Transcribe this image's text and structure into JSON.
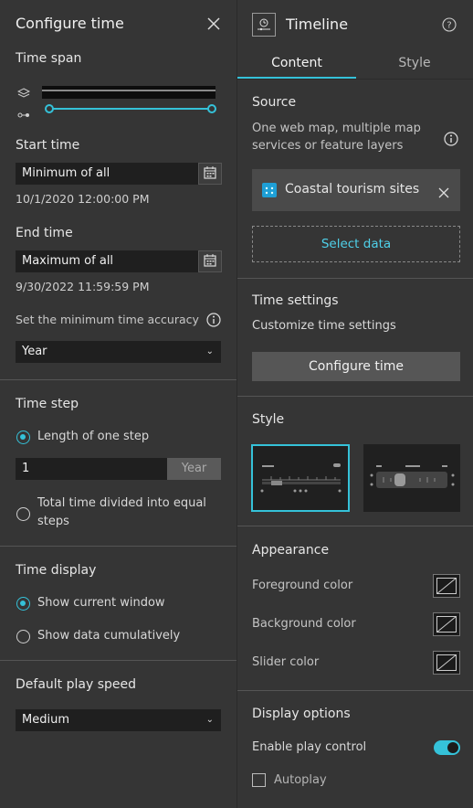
{
  "left": {
    "title": "Configure time",
    "time_span": {
      "label": "Time span"
    },
    "start_time": {
      "label": "Start time",
      "value": "Minimum of all",
      "date": "10/1/2020 12:00:00 PM"
    },
    "end_time": {
      "label": "End time",
      "value": "Maximum of all",
      "date": "9/30/2022 11:59:59 PM"
    },
    "accuracy": {
      "label": "Set the minimum time accuracy",
      "selected": "Year"
    },
    "time_step": {
      "label": "Time step",
      "option_length": "Length of one step",
      "step_value": "1",
      "step_unit": "Year",
      "option_total_line1": "Total time divided into equal",
      "option_total_line2": "steps"
    },
    "time_display": {
      "label": "Time display",
      "option_current": "Show current window",
      "option_cumulative": "Show data cumulatively"
    },
    "play_speed": {
      "label": "Default play speed",
      "selected": "Medium"
    }
  },
  "right": {
    "title": "Timeline",
    "tabs": [
      {
        "label": "Content",
        "active": true
      },
      {
        "label": "Style",
        "active": false
      }
    ],
    "source": {
      "label": "Source",
      "desc_line1": "One web map, multiple map",
      "desc_line2": "services or feature layers",
      "item": "Coastal tourism sites",
      "select_data": "Select data"
    },
    "time_settings": {
      "label": "Time settings",
      "desc": "Customize time settings",
      "button": "Configure time"
    },
    "style": {
      "label": "Style"
    },
    "appearance": {
      "label": "Appearance",
      "foreground": "Foreground color",
      "background": "Background color",
      "slider": "Slider color"
    },
    "display_options": {
      "label": "Display options",
      "enable_play": "Enable play control",
      "enable_play_on": true,
      "autoplay": "Autoplay",
      "autoplay_on": false
    }
  },
  "colors": {
    "accent": "#35c2d9",
    "panel": "#353535",
    "input": "#1f1f1f"
  }
}
